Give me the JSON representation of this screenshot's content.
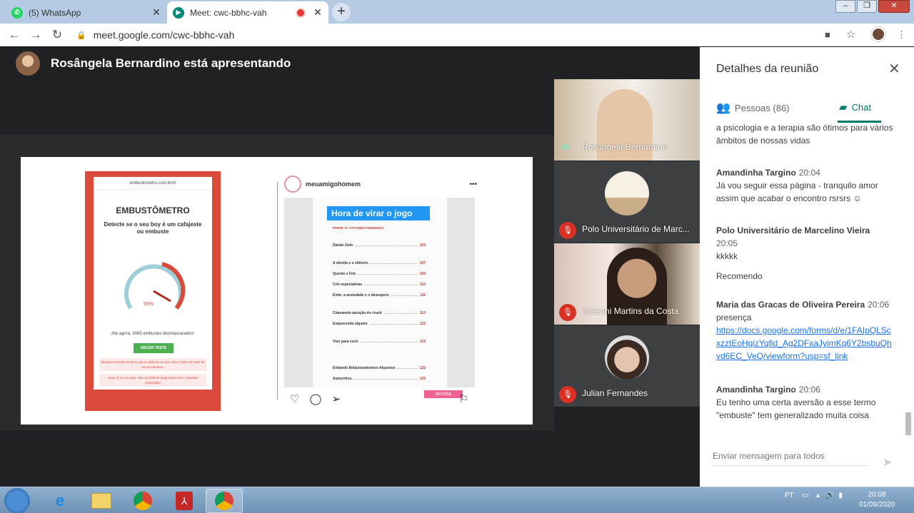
{
  "browser": {
    "tabs": [
      {
        "title": "(5) WhatsApp",
        "favicon": "whatsapp-icon",
        "active": false
      },
      {
        "title": "Meet: cwc-bbhc-vah",
        "favicon": "meet-icon",
        "active": true
      }
    ],
    "url": "meet.google.com/cwc-bbhc-vah"
  },
  "meet": {
    "presenting_text": "Rosângela Bernardino está apresentando",
    "participants": [
      {
        "name": "Rosângela Bernardino",
        "state": "speaking"
      },
      {
        "name": "Polo Universitário de Marc...",
        "state": "muted"
      },
      {
        "name": "Joseani Martins da Costa",
        "state": "muted"
      },
      {
        "name": "Julian Fernandes",
        "state": "muted"
      }
    ]
  },
  "slide": {
    "phone": {
      "address": "embustometro.com.br/#/",
      "title": "EMBUSTÔMETRO",
      "subtitle": "Detecte se o seu boy é um cafajeste ou embuste",
      "gauge_value": "95%",
      "counter": "Até agora, 3065 embustes desmascarados!",
      "button": "INICIAR TESTE",
      "disclaimer1": "Marque somente os itens que se aplicam ao seu caso. Pode ser mais de um ou nenhum.",
      "disclaimer2": "Aviso: É só um jogo. Não se trata de diagnóstico nem conteúdo ressentido!"
    },
    "insta": {
      "account": "meuamigohomem",
      "banner": "Hora de virar o jogo",
      "section": "PARTE VI: ATITUDES FEMININAS",
      "rows": [
        {
          "label": "Dando Gelo",
          "page": "104"
        },
        {
          "label": "A dúvida e o silêncio",
          "page": "107"
        },
        {
          "label": "Quente e Frio",
          "page": "109"
        },
        {
          "label": "Crie expectativas",
          "page": "110"
        },
        {
          "label": "Evite: a ansiedade e o desespero",
          "page": "111"
        },
        {
          "label": "Chamando atenção do crush",
          "page": "113"
        },
        {
          "label": "Esquecendo alguém",
          "page": "115"
        },
        {
          "label": "Vivo para você",
          "page": "119"
        },
        {
          "label": "Evitando Relacionamentos Abusivos",
          "page": "122"
        },
        {
          "label": "Autocrítica",
          "page": "125"
        }
      ],
      "swipe": "arrasta"
    }
  },
  "panel": {
    "title": "Detalhes da reunião",
    "people_tab": "Pessoas (86)",
    "chat_tab": "Chat",
    "messages": [
      {
        "author": "",
        "time": "",
        "text": "a psicologia e a terapia são ótimos para vários âmbitos de nossas vidas"
      },
      {
        "author": "Amandinha Targino",
        "time": "20:04",
        "text": "Já vou seguir essa página - tranquilo amor assim que acabar o encontro rsrsrs ☺"
      },
      {
        "author": "Polo Universitário de Marcelino Vieira",
        "time": "20:05",
        "text": "kkkkk",
        "text2": "Recomendo"
      },
      {
        "author": "Maria das Gracas de Oliveira Pereira",
        "time": "20:06",
        "text": "presença",
        "link": "https://docs.google.com/forms/d/e/1FAIpQLScxzztEoHgizYqfid_Ag2DFxaJyimKq6Y2bsbuQhvd6EC_VeQ/viewform?usp=sf_link"
      },
      {
        "author": "Amandinha Targino",
        "time": "20:06",
        "text": "Eu tenho uma certa aversão a esse termo \"embuste\" tem generalizado muita coisa"
      }
    ],
    "compose_placeholder": "Enviar mensagem para todos"
  },
  "taskbar": {
    "lang": "PT",
    "time": "20:08",
    "date": "01/09/2020"
  },
  "colors": {
    "meet_teal": "#00796b",
    "mute_red": "#d93025",
    "link_blue": "#1a73e8"
  }
}
